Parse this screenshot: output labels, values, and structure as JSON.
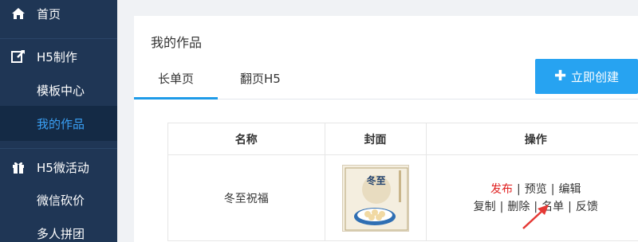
{
  "sidebar": {
    "items": [
      {
        "label": "首页",
        "icon": "home-icon"
      },
      {
        "label": "H5制作",
        "icon": "edit-share-icon"
      },
      {
        "label": "模板中心"
      },
      {
        "label": "我的作品"
      },
      {
        "label": "H5微活动",
        "icon": "gift-icon"
      },
      {
        "label": "微信砍价"
      },
      {
        "label": "多人拼团"
      }
    ],
    "active_color": "#3aa0f5",
    "background": "#1f3655"
  },
  "main": {
    "title": "我的作品",
    "tabs": [
      {
        "label": "长单页",
        "active": true
      },
      {
        "label": "翻页H5",
        "active": false
      }
    ],
    "create_button": {
      "label": "立即创建",
      "icon": "plus-icon"
    },
    "accent_color": "#27a3f1"
  },
  "table": {
    "headers": [
      "名称",
      "封面",
      "操作"
    ],
    "rows": [
      {
        "name": "冬至祝福",
        "cover_text": "冬至",
        "actions_line1": [
          "发布",
          "预览",
          "编辑"
        ],
        "actions_line2": [
          "复制",
          "删除",
          "名单",
          "反馈"
        ]
      }
    ]
  }
}
